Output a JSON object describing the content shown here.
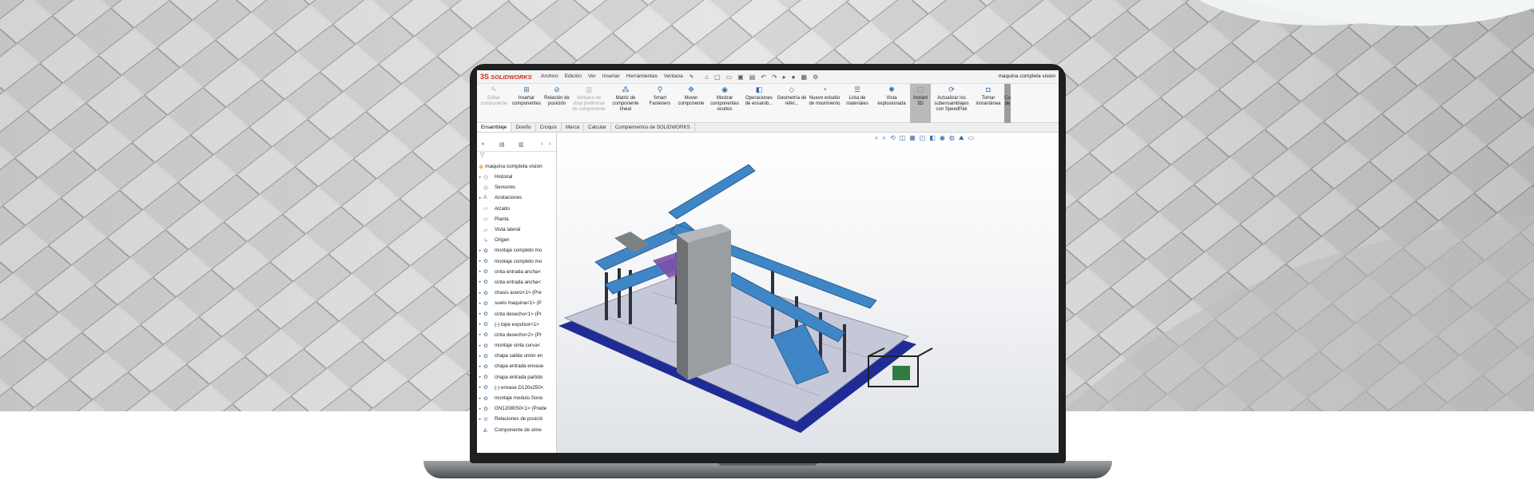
{
  "app": {
    "logo_mark": "3S",
    "logo_text": "SOLIDWORKS",
    "menus": [
      "Archivo",
      "Edición",
      "Ver",
      "Insertar",
      "Herramientas",
      "Ventana"
    ],
    "window_title": "maquina completa vision"
  },
  "ribbon": [
    {
      "label": "Editar componente",
      "icon": "edit-component-icon",
      "enabled": false
    },
    {
      "label": "Insertar componentes",
      "icon": "insert-components-icon",
      "enabled": true
    },
    {
      "label": "Relación de posición",
      "icon": "mate-icon",
      "enabled": true
    },
    {
      "label": "Ventana de vista preliminar de componente",
      "icon": "preview-window-icon",
      "enabled": false
    },
    {
      "label": "Matriz de componente lineal",
      "icon": "linear-pattern-icon",
      "enabled": true
    },
    {
      "label": "Smart Fasteners",
      "icon": "smart-fasteners-icon",
      "enabled": true
    },
    {
      "label": "Mover componente",
      "icon": "move-component-icon",
      "enabled": true
    },
    {
      "label": "Mostrar componentes ocultos",
      "icon": "show-hidden-icon",
      "enabled": true
    },
    {
      "label": "Operaciones de ensamb...",
      "icon": "assembly-features-icon",
      "enabled": true
    },
    {
      "label": "Geometría de refer...",
      "icon": "reference-geometry-icon",
      "enabled": true
    },
    {
      "label": "Nuevo estudio de movimiento",
      "icon": "motion-study-icon",
      "enabled": true
    },
    {
      "label": "Lista de materiales",
      "icon": "bom-icon",
      "enabled": true
    },
    {
      "label": "Vista explosionada",
      "icon": "exploded-view-icon",
      "enabled": true
    },
    {
      "label": "Instant 3D",
      "icon": "instant3d-icon",
      "enabled": true,
      "active": true
    },
    {
      "label": "Actualizar los subensamblajes con SpeedPak",
      "icon": "speedpak-icon",
      "enabled": true
    },
    {
      "label": "Tomar instantánea",
      "icon": "snapshot-icon",
      "enabled": true
    },
    {
      "label": "Co de",
      "icon": "more-icon",
      "enabled": true,
      "partial": true
    }
  ],
  "tabs": [
    "Ensamblaje",
    "Diseño",
    "Croquis",
    "Marca",
    "Calcular",
    "Complementos de SOLIDWORKS"
  ],
  "active_tab": "Ensamblaje",
  "tree": {
    "root": "maquina completa vision",
    "items": [
      {
        "label": "Historial",
        "icon": "history-icon",
        "expandable": true
      },
      {
        "label": "Sensores",
        "icon": "sensor-icon",
        "expandable": false
      },
      {
        "label": "Anotaciones",
        "icon": "annotations-icon",
        "expandable": true
      },
      {
        "label": "Alzado",
        "icon": "plane-icon",
        "expandable": false
      },
      {
        "label": "Planta",
        "icon": "plane-icon",
        "expandable": false
      },
      {
        "label": "Vista lateral",
        "icon": "plane-icon",
        "expandable": false
      },
      {
        "label": "Origen",
        "icon": "origin-icon",
        "expandable": false
      },
      {
        "label": "montaje completo mo",
        "icon": "assembly-icon",
        "expandable": true
      },
      {
        "label": "montaje completo mo",
        "icon": "assembly-icon",
        "expandable": true
      },
      {
        "label": "cinta entrada ancha<",
        "icon": "assembly-icon",
        "expandable": true
      },
      {
        "label": "cinta entrada ancha<",
        "icon": "assembly-icon",
        "expandable": true
      },
      {
        "label": "chasis acero<1> (Pre",
        "icon": "assembly-icon",
        "expandable": true
      },
      {
        "label": "suelo maquina<1> (P",
        "icon": "assembly-icon",
        "expandable": true
      },
      {
        "label": "cinta desecho<1> (Pr",
        "icon": "assembly-icon",
        "expandable": true
      },
      {
        "label": "(-) tope expulsor<1>",
        "icon": "assembly-icon",
        "expandable": true
      },
      {
        "label": "cinta desecho<2> (Pr",
        "icon": "assembly-icon",
        "expandable": true
      },
      {
        "label": "montaje cinta curva<",
        "icon": "assembly-icon",
        "expandable": true
      },
      {
        "label": "chapa salida union en",
        "icon": "assembly-icon",
        "expandable": true
      },
      {
        "label": "chapa entrada envase",
        "icon": "assembly-icon",
        "expandable": true
      },
      {
        "label": "chapa entrada partido",
        "icon": "assembly-icon",
        "expandable": true
      },
      {
        "label": "(-) envase D120x250<",
        "icon": "assembly-icon",
        "expandable": true
      },
      {
        "label": "montaje modulo Sono",
        "icon": "assembly-icon",
        "expandable": true
      },
      {
        "label": "GN12080S0<1> (Prede",
        "icon": "assembly-icon",
        "expandable": true
      },
      {
        "label": "Relaciones de posició",
        "icon": "mates-icon",
        "expandable": true
      },
      {
        "label": "Componente de sime",
        "icon": "mirror-icon",
        "expandable": false
      }
    ]
  },
  "viewport": {
    "model": "maquina completa vision",
    "colors": {
      "conveyor": "#3f86c6",
      "base": "#bfc2d4",
      "frame": "#1f2c96",
      "cabinet": "#8e9294"
    }
  }
}
